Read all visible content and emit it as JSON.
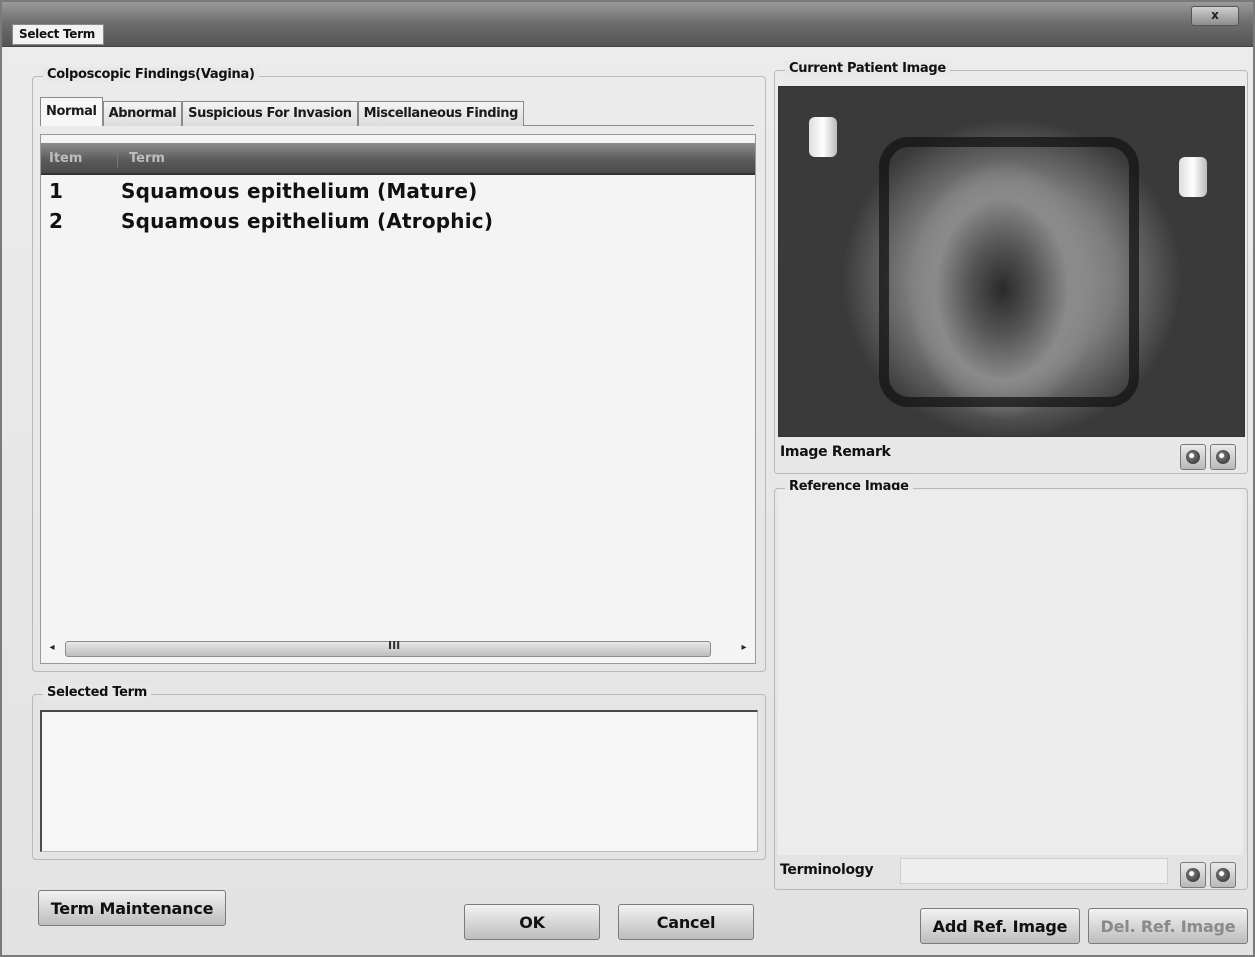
{
  "window": {
    "title": "Select Term",
    "close_label": "x"
  },
  "findings": {
    "legend": "Colposcopic Findings(Vagina)",
    "tabs": [
      {
        "label": "Normal",
        "active": true
      },
      {
        "label": "Abnormal",
        "active": false
      },
      {
        "label": "Suspicious For Invasion",
        "active": false
      },
      {
        "label": "Miscellaneous Finding",
        "active": false
      }
    ],
    "columns": {
      "item": "Item",
      "term": "Term"
    },
    "rows": [
      {
        "item": "1",
        "term": "Squamous epithelium (Mature)"
      },
      {
        "item": "2",
        "term": "Squamous epithelium (Atrophic)"
      }
    ],
    "scroll_grip": "III"
  },
  "selected_term": {
    "legend": "Selected Term",
    "value": ""
  },
  "current_image": {
    "legend": "Current Patient Image",
    "remark_label": "Image Remark"
  },
  "reference_image": {
    "legend": "Reference Image",
    "terminology_label": "Terminology"
  },
  "buttons": {
    "term_maintenance": "Term Maintenance",
    "ok": "OK",
    "cancel": "Cancel",
    "add_ref_image": "Add Ref. Image",
    "del_ref_image": "Del. Ref. Image"
  },
  "icons": {
    "close": "close-icon",
    "nav": "circle-nav-icon",
    "scroll_left": "scroll-left-icon",
    "scroll_right": "scroll-right-icon"
  }
}
